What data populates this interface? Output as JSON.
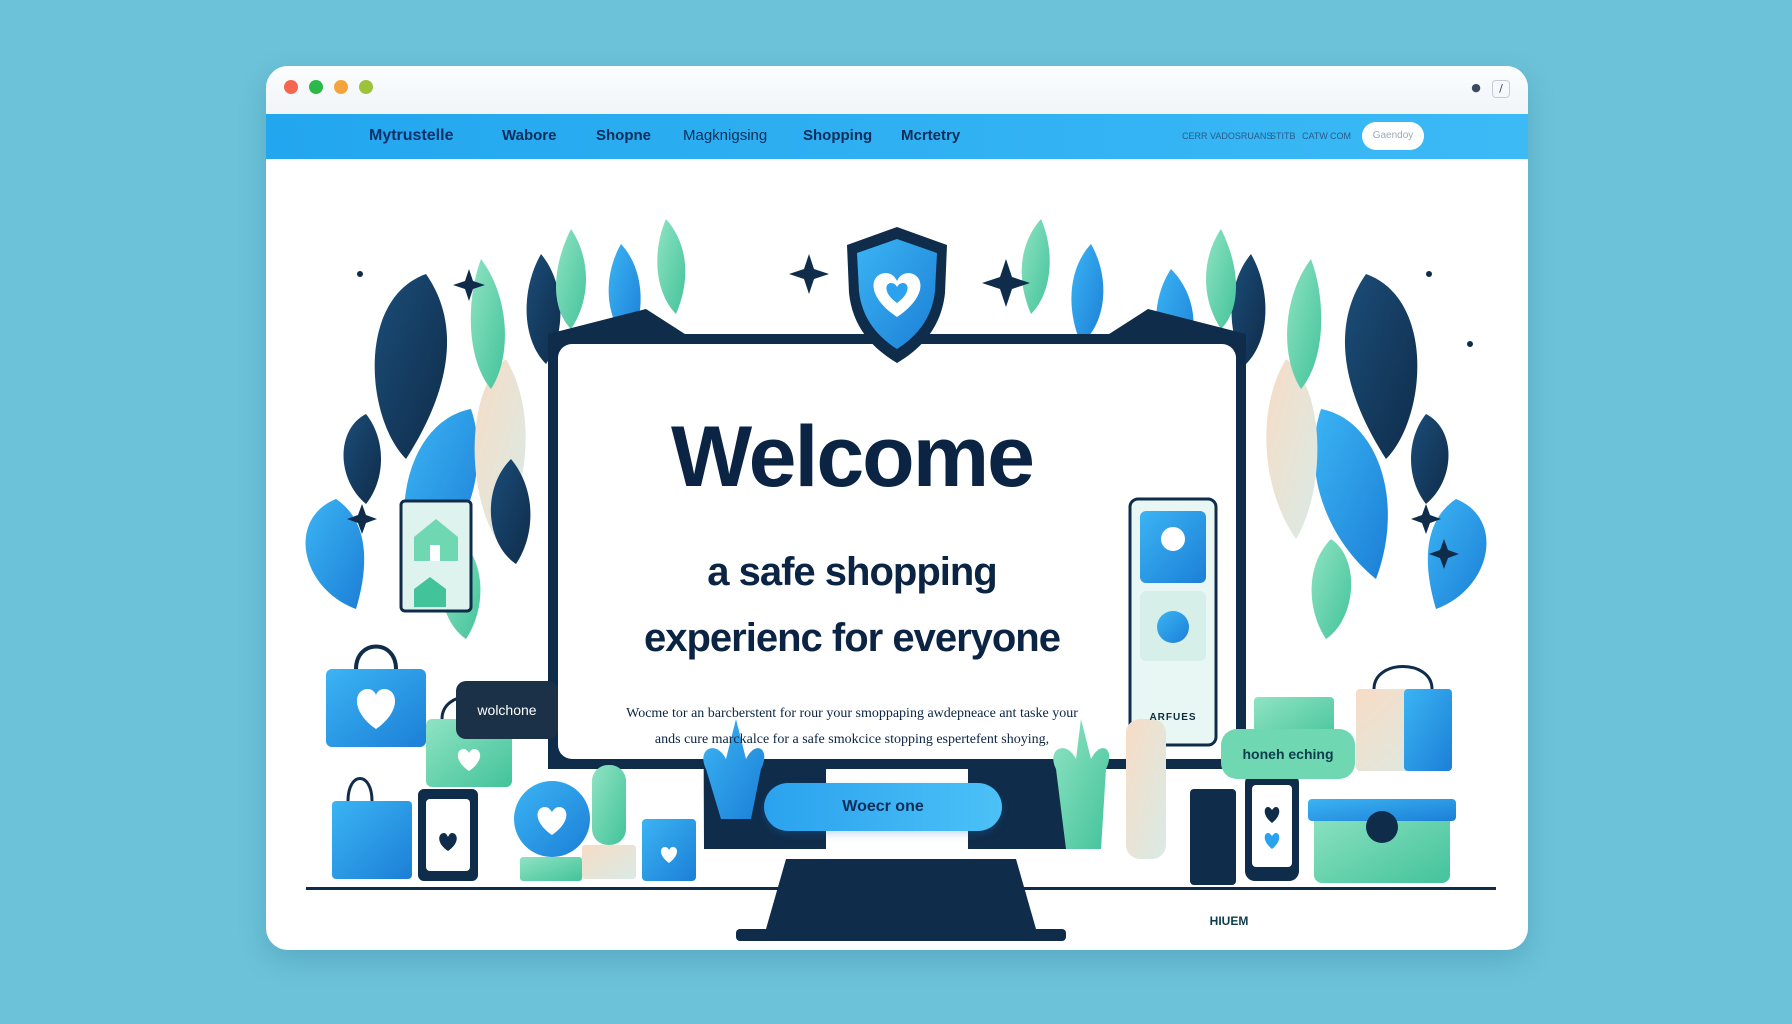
{
  "browser": {
    "controls": [
      "close",
      "minimize",
      "maximize",
      "extra"
    ],
    "colors": {
      "close": "#f4664f",
      "minimize": "#2cb84a",
      "maximize": "#f4a43c",
      "extra": "#9cc33a"
    }
  },
  "nav": {
    "brand": "Mytrustelle",
    "items": [
      "Wabore",
      "Shopne",
      "Magknigsing",
      "Shopping",
      "Mcrtetry"
    ],
    "small_links": [
      "CERR VADOSRUANS",
      "STITB",
      "CATW",
      "COM"
    ],
    "pill_label": "Gaendoy"
  },
  "hero": {
    "title": "Welcome",
    "subtitle_line1": "a safe shopping",
    "subtitle_line2": "experienc for everyone",
    "body_line1": "Wocme tor an barcberstent for rour your smoppaping awdepneace ant taske your",
    "body_line2": "ands cure marckalce for a safe smokcice stopping espertefent shoying,",
    "cta_label": "Woecr one"
  },
  "side_labels": {
    "left_tag": "wolchone",
    "right_tag": "honeh eching",
    "phone_label": "ARFUES",
    "box_label": "HIUEM"
  },
  "icons": [
    "shield-heart-icon",
    "heart-bag-icon",
    "house-icon",
    "phone-heart-icon",
    "cactus-icon",
    "glove-icon",
    "star-sparkle-icon",
    "leaf-icon"
  ],
  "palette": {
    "background": "#6cc3d9",
    "navbar": "#22a6ee",
    "navy": "#0b2444",
    "mint": "#6fd7b2",
    "blue": "#2aa2ee"
  }
}
